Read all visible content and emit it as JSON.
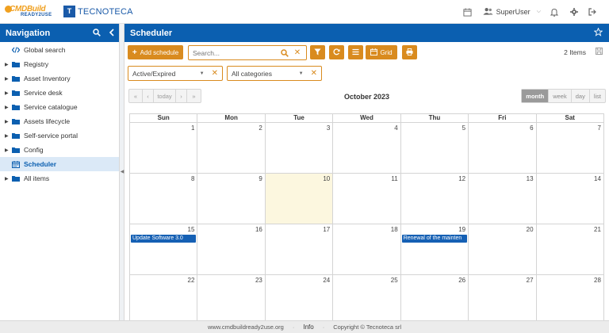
{
  "header": {
    "logo1_main": "CMDBuild",
    "logo1_sub": "READY2USE",
    "logo2_mark": "T",
    "logo2_text": "TECNOTECA",
    "user_name": "SuperUser"
  },
  "nav": {
    "title": "Navigation",
    "items": [
      {
        "label": "Global search",
        "icon": "code-icon",
        "expandable": false
      },
      {
        "label": "Registry",
        "icon": "folder-icon",
        "expandable": true
      },
      {
        "label": "Asset Inventory",
        "icon": "folder-icon",
        "expandable": true
      },
      {
        "label": "Service desk",
        "icon": "folder-icon",
        "expandable": true
      },
      {
        "label": "Service catalogue",
        "icon": "folder-icon",
        "expandable": true
      },
      {
        "label": "Assets lifecycle",
        "icon": "folder-icon",
        "expandable": true
      },
      {
        "label": "Self-service portal",
        "icon": "folder-icon",
        "expandable": true
      },
      {
        "label": "Config",
        "icon": "folder-icon",
        "expandable": true
      },
      {
        "label": "Scheduler",
        "icon": "calendar-icon",
        "expandable": false,
        "active": true
      },
      {
        "label": "All items",
        "icon": "folder-icon",
        "expandable": true
      }
    ]
  },
  "main": {
    "title": "Scheduler",
    "add_label": "Add schedule",
    "search_placeholder": "Search...",
    "grid_label": "Grid",
    "items_count": "2 Items",
    "filter_status": "Active/Expired",
    "filter_category": "All categories"
  },
  "calendar": {
    "nav": [
      "«",
      "‹",
      "today",
      "›",
      "»"
    ],
    "title": "October 2023",
    "views": [
      "month",
      "week",
      "day",
      "list"
    ],
    "active_view": "month",
    "weekdays": [
      "Sun",
      "Mon",
      "Tue",
      "Wed",
      "Thu",
      "Fri",
      "Sat"
    ],
    "weeks": [
      [
        1,
        2,
        3,
        4,
        5,
        6,
        7
      ],
      [
        8,
        9,
        10,
        11,
        12,
        13,
        14
      ],
      [
        15,
        16,
        17,
        18,
        19,
        20,
        21
      ],
      [
        22,
        23,
        24,
        25,
        26,
        27,
        28
      ]
    ],
    "today": 10,
    "events": [
      {
        "day": 15,
        "title": "Update Software 3.0"
      },
      {
        "day": 19,
        "title": "Renewal of the mainten"
      }
    ],
    "event_color": "#1560b4"
  },
  "footer": {
    "site": "www.cmdbuildready2use.org",
    "info": "Info",
    "copyright": "Copyright © Tecnoteca srl"
  },
  "colors": {
    "primary": "#0b5fb0",
    "accent": "#d98b1f",
    "today_bg": "#fcf7df"
  }
}
